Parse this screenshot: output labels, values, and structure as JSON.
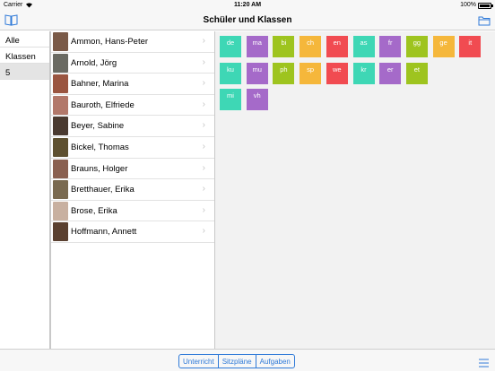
{
  "status_bar": {
    "carrier": "Carrier",
    "time": "11:20 AM",
    "battery": "100%"
  },
  "nav": {
    "title": "Schüler und Klassen",
    "left_icon": "book-icon",
    "right_icon": "folder-icon"
  },
  "sidebar": {
    "items": [
      {
        "label": "Alle",
        "selected": false
      },
      {
        "label": "Klassen",
        "selected": false
      },
      {
        "label": "5",
        "selected": true
      }
    ]
  },
  "students": [
    {
      "name": "Ammon, Hans-Peter",
      "avatar_color": "#7a5a48"
    },
    {
      "name": "Arnold, Jörg",
      "avatar_color": "#6a6a62"
    },
    {
      "name": "Bahner, Marina",
      "avatar_color": "#9a5540"
    },
    {
      "name": "Bauroth, Elfriede",
      "avatar_color": "#b2786a"
    },
    {
      "name": "Beyer, Sabine",
      "avatar_color": "#4a3a30"
    },
    {
      "name": "Bickel, Thomas",
      "avatar_color": "#5e5030"
    },
    {
      "name": "Brauns, Holger",
      "avatar_color": "#8a6050"
    },
    {
      "name": "Bretthauer, Erika",
      "avatar_color": "#7a6a50"
    },
    {
      "name": "Brose, Erika",
      "avatar_color": "#c8b0a0"
    },
    {
      "name": "Hoffmann, Annett",
      "avatar_color": "#5a4030"
    }
  ],
  "classes": [
    [
      {
        "label": "de",
        "color": "#3ed7b5"
      },
      {
        "label": "ma",
        "color": "#a56ac9"
      },
      {
        "label": "bi",
        "color": "#9ec41f"
      },
      {
        "label": "ch",
        "color": "#f5b73b"
      },
      {
        "label": "en",
        "color": "#f14b51"
      },
      {
        "label": "as",
        "color": "#3ed7b5"
      },
      {
        "label": "fr",
        "color": "#a56ac9"
      },
      {
        "label": "gg",
        "color": "#9ec41f"
      },
      {
        "label": "ge",
        "color": "#f5b73b"
      },
      {
        "label": "it",
        "color": "#f14b51"
      }
    ],
    [
      {
        "label": "ku",
        "color": "#3ed7b5"
      },
      {
        "label": "mu",
        "color": "#a56ac9"
      },
      {
        "label": "ph",
        "color": "#9ec41f"
      },
      {
        "label": "sp",
        "color": "#f5b73b"
      },
      {
        "label": "we",
        "color": "#f14b51"
      },
      {
        "label": "kr",
        "color": "#3ed7b5"
      },
      {
        "label": "er",
        "color": "#a56ac9"
      },
      {
        "label": "et",
        "color": "#9ec41f"
      }
    ],
    [
      {
        "label": "mi",
        "color": "#3ed7b5"
      },
      {
        "label": "vh",
        "color": "#a56ac9"
      }
    ]
  ],
  "tabs": [
    {
      "label": "Unterricht"
    },
    {
      "label": "Sitzpläne"
    },
    {
      "label": "Aufgaben"
    }
  ],
  "accent": "#2f7ad8"
}
